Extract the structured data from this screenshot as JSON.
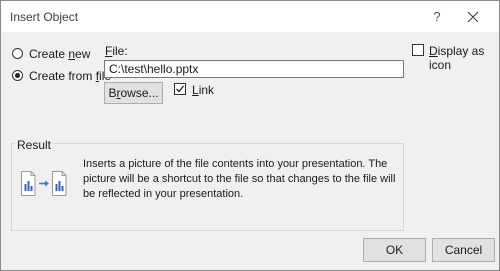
{
  "dialog": {
    "title": "Insert Object",
    "help_glyph": "?"
  },
  "options": {
    "create_new": {
      "pre": "Create ",
      "accel": "n",
      "post": "ew",
      "selected": false
    },
    "create_from_file": {
      "pre": "Create from ",
      "accel": "f",
      "post": "ile",
      "selected": true
    }
  },
  "file": {
    "label_accel": "F",
    "label_rest": "ile:",
    "value": "C:\\test\\hello.pptx",
    "browse_pre": "B",
    "browse_accel": "r",
    "browse_post": "owse..."
  },
  "link": {
    "accel": "L",
    "rest": "ink",
    "checked": true
  },
  "display_as_icon": {
    "accel": "D",
    "rest": "isplay as icon",
    "checked": false
  },
  "result": {
    "title": "Result",
    "text": "Inserts a picture of the file contents into your presentation. The picture will be a shortcut to the file so that changes to the file will be reflected in your presentation.",
    "icon": "linked-file-icon"
  },
  "buttons": {
    "ok": "OK",
    "cancel": "Cancel"
  },
  "colors": {
    "accent": "#2b6cb0",
    "dialog_bg": "#f0f0f0",
    "title_bg": "#ffffff"
  }
}
